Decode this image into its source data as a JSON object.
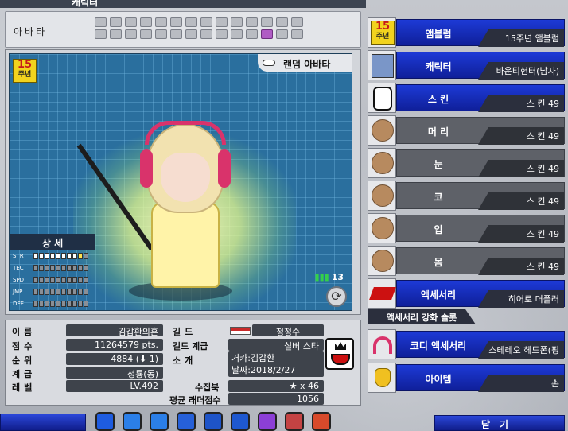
{
  "window": {
    "title": "캐릭터"
  },
  "avatar_bar": {
    "label": "아바타",
    "slots_row1": [
      false,
      false,
      false,
      false,
      false,
      false,
      false,
      false,
      false,
      false,
      false,
      false,
      false,
      false
    ],
    "slots_row2": [
      false,
      false,
      false,
      false,
      false,
      false,
      false,
      false,
      false,
      false,
      false,
      true,
      false,
      false
    ]
  },
  "preview": {
    "badge_15_top": "15",
    "badge_15_bottom": "주년",
    "random_avatar_label": "랜덤 아바타",
    "detail_header": "상 세",
    "stats": [
      {
        "label": "STR",
        "filled": 9,
        "highlight": 1
      },
      {
        "label": "TEC",
        "filled": 0,
        "highlight": 0
      },
      {
        "label": "SPD",
        "filled": 0,
        "highlight": 0
      },
      {
        "label": "JMP",
        "filled": 0,
        "highlight": 0
      },
      {
        "label": "DEF",
        "filled": 0,
        "highlight": 0
      }
    ],
    "signal_value": "13"
  },
  "info": {
    "name_label": "이름",
    "name_value": "김갑환의흔",
    "score_label": "점수",
    "score_value": "11264579 pts.",
    "rank_label": "순위",
    "rank_value": "4884 (⬇ 1)",
    "class_label": "계급",
    "class_value": "청룡(동)",
    "level_label": "레벨",
    "level_value": "LV.492",
    "guild_label": "길드",
    "guild_value": "청정수",
    "guild_rank_label": "길드 계급",
    "guild_rank_value": "실버 스타",
    "intro_label": "소개",
    "intro_line1": "거카:김갑환",
    "intro_line2": "날짜:2018/2/27",
    "collection_label": "수집북",
    "collection_value": "★ x 46",
    "ladder_label": "평균 래더점수",
    "ladder_value": "1056"
  },
  "right_panel": {
    "rows": [
      {
        "category": "앰블럼",
        "value": "15주년 앰블럼",
        "style": "blue",
        "icon": "emblem-15th-icon"
      },
      {
        "category": "캐릭터",
        "value": "바운티헌터(남자)",
        "style": "blue",
        "icon": "character-portrait-icon"
      },
      {
        "category": "스 킨",
        "value": "스 킨 49",
        "style": "blue",
        "icon": "skin-icon"
      },
      {
        "category": "머 리",
        "value": "스 킨 49",
        "style": "gray",
        "icon": "head-icon"
      },
      {
        "category": "눈",
        "value": "스 킨 49",
        "style": "gray",
        "icon": "eyes-icon"
      },
      {
        "category": "코",
        "value": "스 킨 49",
        "style": "gray",
        "icon": "nose-icon"
      },
      {
        "category": "입",
        "value": "스 킨 49",
        "style": "gray",
        "icon": "mouth-icon"
      },
      {
        "category": "몸",
        "value": "스 킨 49",
        "style": "gray",
        "icon": "body-icon"
      },
      {
        "category": "액세서리",
        "value": "히어로 머플러",
        "style": "blue",
        "icon": "accessory-icon"
      }
    ],
    "enhance_slot_label": "액세서리 강화 슬롯",
    "coordi_rows": [
      {
        "category": "코디 액세서리",
        "value": "스테레오 헤드폰(핑크)",
        "style": "blue",
        "icon": "headphone-icon"
      },
      {
        "category": "아이템",
        "value": "손",
        "style": "blue",
        "icon": "hand-icon"
      }
    ]
  },
  "bottom_bar": {
    "close_label": "닫기",
    "icon_colors": [
      "#1e5ce0",
      "#2b7fe8",
      "#2b7fe8",
      "#2660d8",
      "#1e54c8",
      "#1e58d0",
      "#8c3fd6",
      "#c44343",
      "#d84a2b"
    ]
  }
}
